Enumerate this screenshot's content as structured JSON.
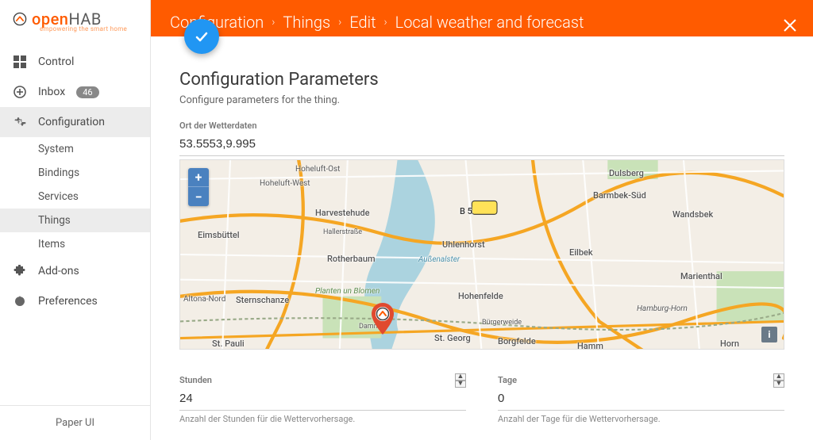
{
  "app": {
    "name": "openHAB",
    "tagline": "empowering the smart home"
  },
  "sidebar": {
    "items": [
      {
        "icon": "dashboard",
        "label": "Control"
      },
      {
        "icon": "inbox",
        "label": "Inbox",
        "badge": "46"
      },
      {
        "icon": "gear",
        "label": "Configuration",
        "active": true,
        "children": [
          {
            "label": "System"
          },
          {
            "label": "Bindings"
          },
          {
            "label": "Services"
          },
          {
            "label": "Things",
            "active": true
          },
          {
            "label": "Items"
          }
        ]
      },
      {
        "icon": "puzzle",
        "label": "Add-ons"
      },
      {
        "icon": "star",
        "label": "Preferences"
      }
    ],
    "footer": "Paper UI"
  },
  "header": {
    "breadcrumbs": [
      "Configuration",
      "Things",
      "Edit",
      "Local weather and forecast"
    ]
  },
  "content": {
    "title": "Configuration Parameters",
    "subtitle": "Configure parameters for the thing.",
    "fields": {
      "location": {
        "label": "Ort der Wetterdaten",
        "value": "53.5553,9.995"
      },
      "hours": {
        "label": "Stunden",
        "value": "24",
        "help": "Anzahl der Stunden für die Wettervorhersage."
      },
      "days": {
        "label": "Tage",
        "value": "0",
        "help": "Anzahl der Tage für die Wettervorhersage."
      }
    },
    "map": {
      "road_label": "B 5",
      "places": [
        "Hoheluft-Ost",
        "Hoheluft-West",
        "Dulsberg",
        "Barmbek-Süd",
        "Wandsbek",
        "Eimsbüttel",
        "Harvestehude",
        "Uhlenhorst",
        "Außenalster",
        "Rotherbaum",
        "Eilbek",
        "Marienthal",
        "Sternschanze",
        "Planten un Blomen",
        "Hohenfelde",
        "Borgfelde",
        "St. Georg",
        "Hamm",
        "Horn",
        "St. Pauli",
        "Altona-Nord",
        "Hamburg-Horn",
        "Bürgerweide",
        "Hallerstraße",
        "Dammtor"
      ]
    }
  }
}
